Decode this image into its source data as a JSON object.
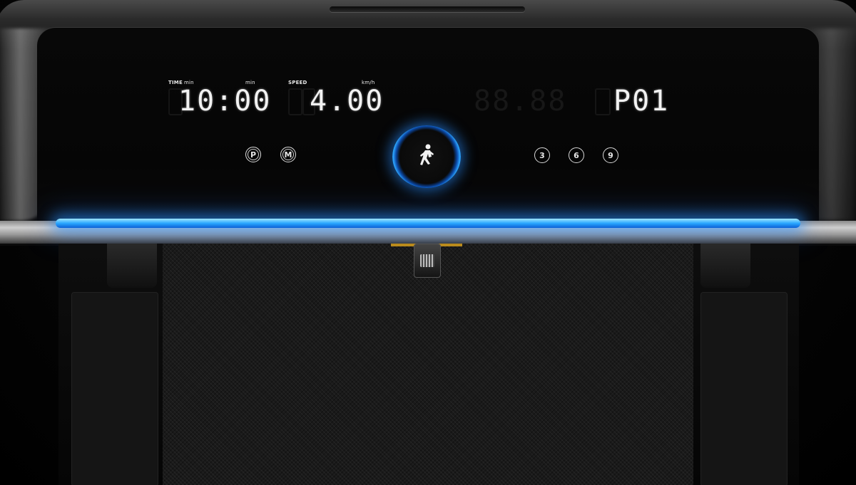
{
  "console": {
    "time": {
      "label": "TIME",
      "unit_left": "min",
      "unit_right": "min",
      "value": "10:00"
    },
    "speed": {
      "label": "SPEED",
      "unit": "km/h",
      "value": "4.00"
    },
    "distance": {
      "ghost_value": "88.88"
    },
    "program": {
      "value": "P01"
    },
    "mode_buttons": [
      {
        "label": "P"
      },
      {
        "label": "M"
      }
    ],
    "speed_presets": [
      {
        "label": "3"
      },
      {
        "label": "6"
      },
      {
        "label": "9"
      }
    ],
    "start_icon": "runner-icon",
    "accent_color": "#2aa7ff"
  }
}
